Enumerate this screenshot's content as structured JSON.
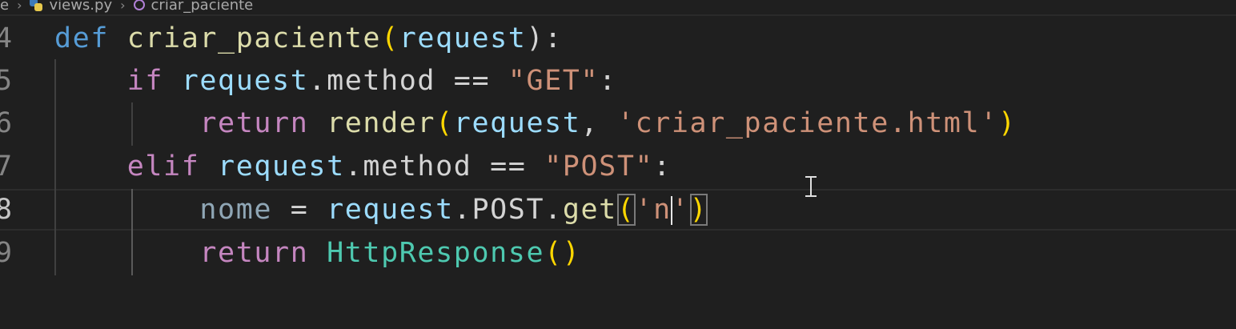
{
  "breadcrumb": {
    "folder": "e",
    "file": "views.py",
    "symbol": "criar_paciente",
    "file_icon": "python-file-icon",
    "symbol_icon": "function-symbol-icon"
  },
  "lines": [
    {
      "num": "4",
      "tokens": {
        "t1": "def",
        "t2": " ",
        "t3": "criar_paciente",
        "t4": "(",
        "t5": "request",
        "t6": "):"
      }
    },
    {
      "num": "5",
      "tokens": {
        "t1": "    ",
        "t2": "if",
        "t3": " ",
        "t4": "request",
        "t5": ".method == ",
        "t6": "\"GET\"",
        "t7": ":"
      }
    },
    {
      "num": "6",
      "tokens": {
        "t1": "        ",
        "t2": "return",
        "t3": " ",
        "t4": "render",
        "t5": "(",
        "t6": "request",
        "t7": ", ",
        "t8": "'criar_paciente.html'",
        "t9": ")"
      }
    },
    {
      "num": "7",
      "tokens": {
        "t1": "    ",
        "t2": "elif",
        "t3": " ",
        "t4": "request",
        "t5": ".method == ",
        "t6": "\"POST\"",
        "t7": ":"
      }
    },
    {
      "num": "8",
      "tokens": {
        "t1": "        ",
        "t2": "nome",
        "t3": " = ",
        "t4": "request",
        "t5": ".POST.",
        "t6": "get",
        "t7": "(",
        "t8": "'n",
        "t9": "'",
        "t10": ")"
      }
    },
    {
      "num": "9",
      "tokens": {
        "t1": "        ",
        "t2": "return",
        "t3": " ",
        "t4": "HttpResponse",
        "t5": "()"
      }
    }
  ],
  "colors": {
    "background": "#1f1f1f",
    "keyword": "#569cd6",
    "control": "#c586c0",
    "function": "#dcdcaa",
    "variable": "#9cdcfe",
    "string": "#ce9178",
    "class": "#4ec9b0",
    "bracket": "#ffd700"
  }
}
